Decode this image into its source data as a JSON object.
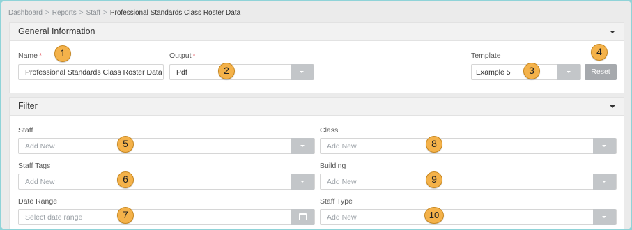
{
  "breadcrumb": [
    {
      "label": "Dashboard"
    },
    {
      "label": "Reports"
    },
    {
      "label": "Staff"
    },
    {
      "label": "Professional Standards Class Roster Data"
    }
  ],
  "breadcrumb_sep": ">",
  "general": {
    "title": "General Information",
    "name_label": "Name",
    "name_value": "Professional Standards Class Roster Data",
    "output_label": "Output",
    "output_value": "Pdf",
    "template_label": "Template",
    "template_value": "Example 5",
    "reset_label": "Reset",
    "required_mark": "*"
  },
  "filter": {
    "title": "Filter",
    "staff_label": "Staff",
    "staff_placeholder": "Add New",
    "staff_tags_label": "Staff Tags",
    "staff_tags_placeholder": "Add New",
    "date_range_label": "Date Range",
    "date_range_placeholder": "Select date range",
    "class_label": "Class",
    "class_placeholder": "Add New",
    "building_label": "Building",
    "building_placeholder": "Add New",
    "staff_type_label": "Staff Type",
    "staff_type_placeholder": "Add New"
  },
  "callouts": [
    "1",
    "2",
    "3",
    "4",
    "5",
    "6",
    "7",
    "8",
    "9",
    "10"
  ],
  "colors": {
    "callout": "#f4b24a",
    "required": "#e0424b",
    "border": "#8fd3d8"
  },
  "icons": [
    "caret-down-icon",
    "calendar-icon",
    "dropdown-arrow-icon"
  ]
}
